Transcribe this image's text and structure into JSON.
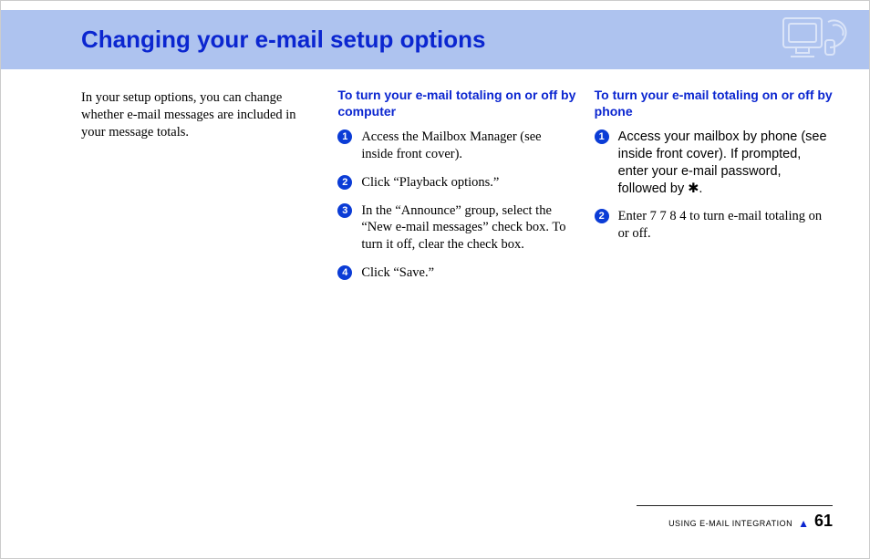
{
  "header": {
    "title": "Changing your e-mail setup options"
  },
  "intro": "In your setup options, you can change whether e-mail messages are included in your message totals.",
  "col2": {
    "heading": "To turn your e-mail totaling on or off by computer",
    "steps": [
      "Access the Mailbox Manager (see inside front cover).",
      "Click “Playback options.”",
      "In the “Announce” group, select the “New e-mail messages” check box. To turn it off, clear the check box.",
      "Click “Save.”"
    ]
  },
  "col3": {
    "heading": "To turn your e-mail totaling on or off by phone",
    "steps": [
      "Access your mailbox by phone (see inside front cover). If prompted, enter your e-mail password, followed by ✱.",
      "Enter 7 7 8 4 to turn e-mail totaling on or off."
    ]
  },
  "footer": {
    "section": "USING E-MAIL INTEGRATION",
    "page": "61"
  }
}
